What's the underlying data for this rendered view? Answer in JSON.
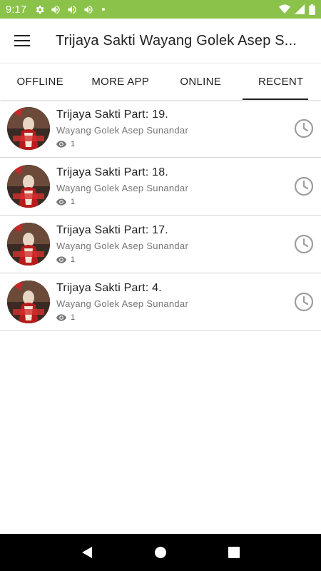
{
  "status_bar": {
    "time": "9:17",
    "left_icons": [
      "gear-icon",
      "volume-icon",
      "volume-icon",
      "volume-icon"
    ],
    "right_icons": [
      "wifi-icon",
      "signal-icon",
      "battery-icon"
    ]
  },
  "app_bar": {
    "menu_icon": "hamburger-menu-icon",
    "title": "Trijaya Sakti Wayang Golek Asep S..."
  },
  "tabs": [
    {
      "label": "OFFLINE",
      "active": false
    },
    {
      "label": "MORE APP",
      "active": false
    },
    {
      "label": "ONLINE",
      "active": false
    },
    {
      "label": "RECENT",
      "active": true
    }
  ],
  "items": [
    {
      "title": "Trijaya Sakti Part: 19.",
      "subtitle": "Wayang Golek Asep Sunandar",
      "views": "1"
    },
    {
      "title": "Trijaya Sakti Part: 18.",
      "subtitle": "Wayang Golek Asep Sunandar",
      "views": "1"
    },
    {
      "title": "Trijaya Sakti Part: 17.",
      "subtitle": "Wayang Golek Asep Sunandar",
      "views": "1"
    },
    {
      "title": "Trijaya Sakti Part: 4.",
      "subtitle": "Wayang Golek Asep Sunandar",
      "views": "1"
    }
  ],
  "colors": {
    "status_bar": "#8bc34a",
    "text_primary": "#212121",
    "text_secondary": "#757575",
    "icon_grey": "#9e9e9e"
  },
  "nav_bar": {
    "icons": [
      "back-icon",
      "home-icon",
      "recents-icon"
    ]
  }
}
